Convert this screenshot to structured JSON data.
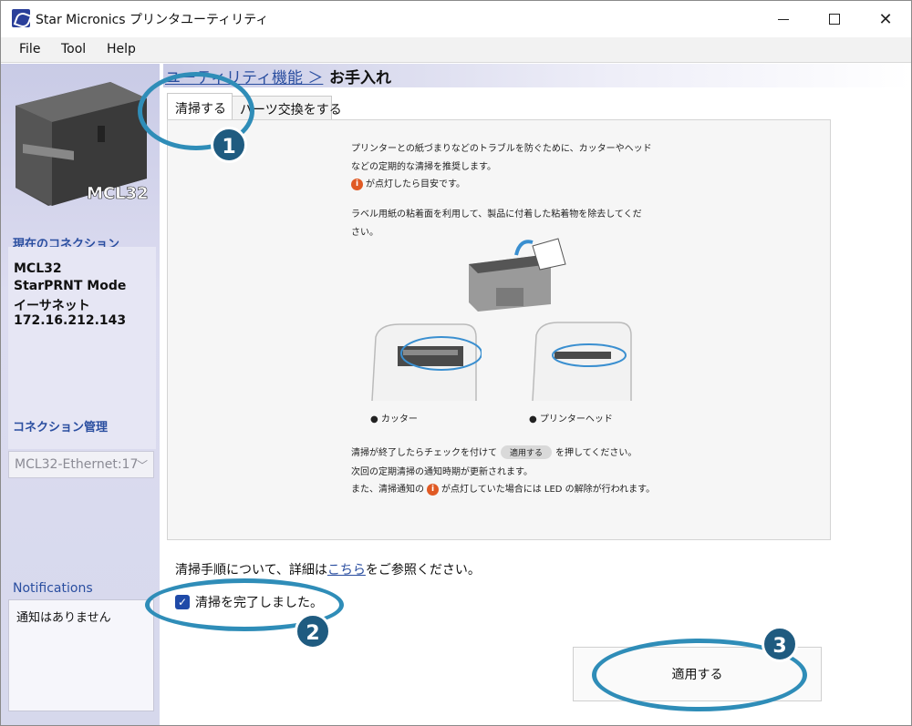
{
  "window": {
    "title": "Star Micronics プリンタユーティリティ",
    "minimize_glyph": "—",
    "maximize_glyph": "☐",
    "close_glyph": "✕"
  },
  "menu": {
    "items": [
      "File",
      "Tool",
      "Help"
    ]
  },
  "sidebar": {
    "printer_model_label": "MCL32",
    "current_connection_heading": "現在のコネクション",
    "connection_lines": [
      "MCL32",
      "StarPRNT Mode",
      "イーサネット",
      "172.16.212.143"
    ],
    "connection_mgmt_heading": "コネクション管理",
    "connection_select_value": "MCL32-Ethernet:17",
    "notifications_heading": "Notifications",
    "notifications_text": "通知はありません"
  },
  "breadcrumb": {
    "parent": "ユーティリティ機能 ＞",
    "current": "お手入れ"
  },
  "tabs": [
    {
      "label": "清掃する",
      "active": true
    },
    {
      "label": "パーツ交換をする",
      "active": false
    }
  ],
  "panel": {
    "intro_line1": "プリンターとの紙づまりなどのトラブルを防ぐために、カッターやヘッド",
    "intro_line2": "などの定期的な清掃を推奨します。",
    "intro_line3": "が点灯したら目安です。",
    "label_line1": "ラベル用紙の粘着面を利用して、製品に付着した粘着物を除去してくだ",
    "label_line2": "さい。",
    "caption_cutter": "● カッター",
    "caption_head": "● プリンターヘッド",
    "after_line1_a": "清掃が終了したらチェックを付けて",
    "after_line1_chip": "適用する",
    "after_line1_b": "を押してください。",
    "after_line2": "次回の定期清掃の通知時期が更新されます。",
    "after_line3_a": "また、清掃通知の",
    "after_line3_b": "が点灯していた場合には LED の解除が行われます。",
    "info_glyph": "i"
  },
  "details": {
    "prefix": "清掃手順について、詳細は",
    "link": "こちら",
    "suffix": "をご参照ください。"
  },
  "checkbox": {
    "label": "清掃を完了しました。",
    "checked": true
  },
  "apply_button": "適用する",
  "callouts": [
    "1",
    "2",
    "3"
  ],
  "colors": {
    "accent": "#2a4ea0",
    "callout": "#2f8db8",
    "badge": "#1f5b80",
    "info": "#e05a24"
  }
}
